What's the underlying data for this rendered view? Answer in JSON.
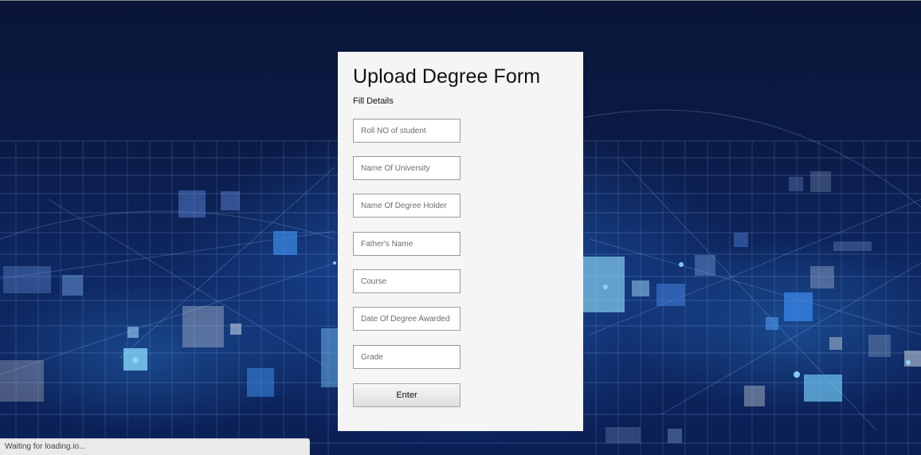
{
  "form": {
    "title": "Upload Degree Form",
    "subtitle": "Fill Details",
    "fields": [
      {
        "name": "roll-no-field",
        "placeholder": "Roll NO of student",
        "value": ""
      },
      {
        "name": "university-name-field",
        "placeholder": "Name Of University",
        "value": ""
      },
      {
        "name": "degree-holder-name-field",
        "placeholder": "Name Of Degree Holder",
        "value": ""
      },
      {
        "name": "father-name-field",
        "placeholder": "Father's Name",
        "value": ""
      },
      {
        "name": "course-field",
        "placeholder": "Course",
        "value": ""
      },
      {
        "name": "degree-date-field",
        "placeholder": "Date Of Degree Awarded",
        "value": ""
      },
      {
        "name": "grade-field",
        "placeholder": "Grade",
        "value": ""
      }
    ],
    "submit_label": "Enter"
  },
  "status_bar": {
    "text": "Waiting for loading.io..."
  },
  "colors": {
    "background": "#0b1f55",
    "card": "#f5f5f5",
    "accent_glow": "#3a8fe0"
  }
}
